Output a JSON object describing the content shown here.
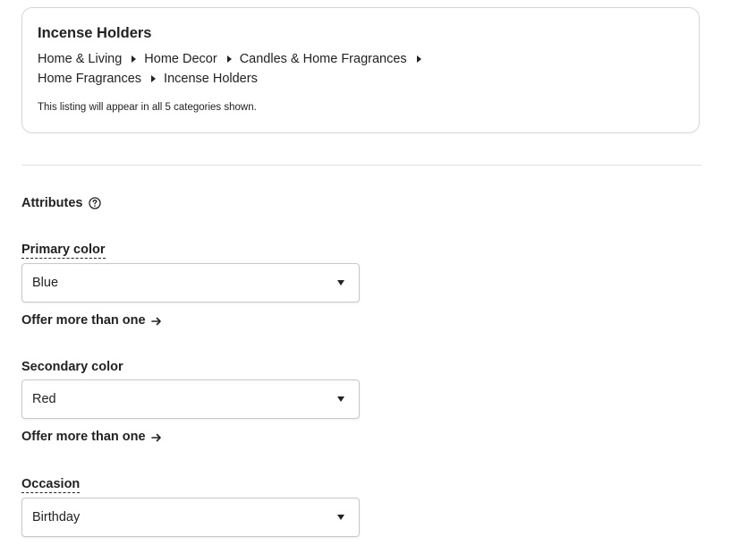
{
  "category": {
    "title": "Incense Holders",
    "breadcrumb": [
      "Home & Living",
      "Home Decor",
      "Candles & Home Fragrances",
      "Home Fragrances",
      "Incense Holders"
    ],
    "note": "This listing will appear in all 5 categories shown."
  },
  "attributes": {
    "heading": "Attributes",
    "help_icon": "question-circle-icon"
  },
  "fields": {
    "primary_color": {
      "label": "Primary color",
      "value": "Blue",
      "offer_more": "Offer more than one"
    },
    "secondary_color": {
      "label": "Secondary color",
      "value": "Red",
      "offer_more": "Offer more than one"
    },
    "occasion": {
      "label": "Occasion",
      "value": "Birthday"
    }
  },
  "icons": {
    "breadcrumb_separator": "triangle-right-icon",
    "select_caret": "caret-down-icon",
    "offer_arrow": "arrow-right-icon"
  }
}
